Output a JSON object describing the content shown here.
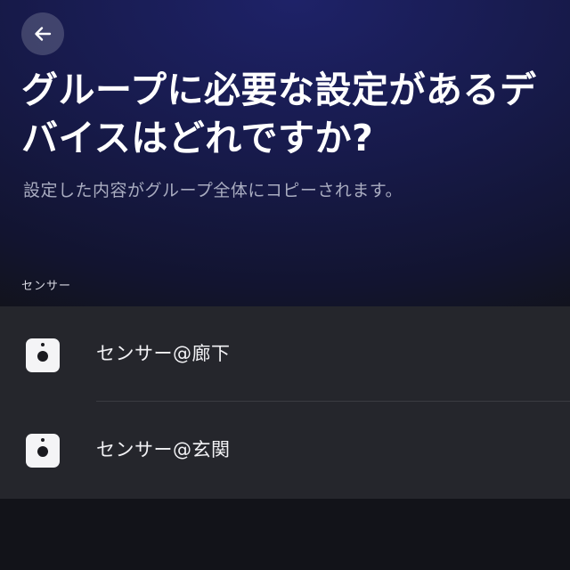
{
  "header": {
    "back_icon": "arrow-left-icon",
    "title": "グループに必要な設定があるデバイスはどれですか?",
    "subtitle": "設定した内容がグループ全体にコピーされます。"
  },
  "section": {
    "label": "センサー"
  },
  "devices": [
    {
      "icon": "motion-sensor-icon",
      "label": "センサー@廊下"
    },
    {
      "icon": "motion-sensor-icon",
      "label": "センサー@玄関"
    }
  ],
  "colors": {
    "background_top": "#1e2268",
    "background_bottom": "#121319",
    "list_background": "#25262c",
    "subtitle_text": "#a9acc0",
    "icon_tile": "#f4f4f6"
  }
}
